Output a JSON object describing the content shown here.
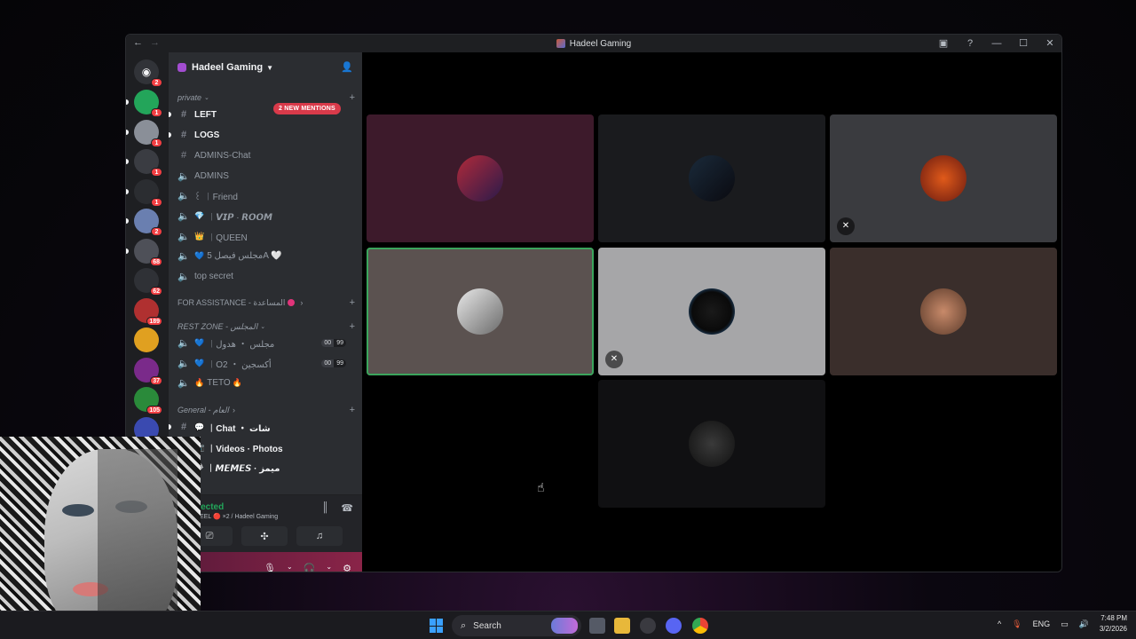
{
  "window": {
    "title": "Hadeel Gaming",
    "nav_back": "←",
    "nav_forward": "→",
    "controls": {
      "inbox": "▣",
      "help": "?",
      "minimize": "—",
      "maximize": "☐",
      "close": "✕"
    }
  },
  "server_rail": {
    "home_icon": "discord-logo-icon",
    "home_badge": "2",
    "servers": [
      {
        "badge": "1",
        "color": "#23a55a"
      },
      {
        "badge": "1",
        "color": "#8a8f98"
      },
      {
        "badge": "1",
        "color": "#3a3c42"
      },
      {
        "badge": "1",
        "color": "#2b2d31"
      },
      {
        "badge": "2",
        "color": "#6a7fb0"
      },
      {
        "badge": "68",
        "color": "#4e5058"
      },
      {
        "badge": "62",
        "color": "#2f3136"
      },
      {
        "badge": "189",
        "color": "#b03030"
      },
      {
        "badge": "",
        "color": "#e0a020"
      },
      {
        "badge": "37",
        "color": "#7a2a8a"
      },
      {
        "badge": "105",
        "color": "#2a8a3a"
      },
      {
        "badge": "674",
        "color": "#3a4ab0"
      }
    ]
  },
  "guild": {
    "name": "Hadeel Gaming",
    "mentions_label": "2 NEW MENTIONS"
  },
  "categories": {
    "private": "private",
    "assistance": "FOR ASSISTANCE - المساعدة",
    "rest_zone": "REST ZONE - المجلس",
    "general": "General - العام"
  },
  "channels": {
    "left": "LEFT",
    "logs": "LOGS",
    "admins_chat": "ADMINS-Chat",
    "admins": "ADMINS",
    "friend": "꒰ ︱Friend",
    "vip": "︱𝙑𝙄𝙋 · 𝙍𝙊𝙊𝙈",
    "queen": "︱QUEEN",
    "majlis_faisal": "مجلس فيصل 5A 🤍",
    "top_secret": "top secret",
    "majlis_hadol": "︱مجلس ・ هدول",
    "oxygen": "︱O2 ・ أكسجين",
    "teto": "TETO",
    "chat": "︱Chat ・ شات",
    "videos": "︱Videos · Photos",
    "memes": "︱𝙈𝙀𝙈𝙀𝙎 · ميمز"
  },
  "voice_limits": {
    "hadol": [
      "00",
      "99"
    ],
    "oxygen": [
      "00",
      "99"
    ]
  },
  "voice": {
    "status": "nected",
    "sub": "DEEL 🔴 ×2 / Hadeel Gaming"
  },
  "taskbar": {
    "search_placeholder": "Search",
    "lang": "ENG",
    "time": "7:48 PM",
    "date": "3/2/2026"
  },
  "tiles": [
    {
      "bg": "#3d1a2b",
      "muted": false,
      "active": false,
      "avatar": "linear-gradient(135deg,#b02a3a,#2a1a4a)"
    },
    {
      "bg": "#1a1b1e",
      "muted": false,
      "active": false,
      "avatar": "linear-gradient(135deg,#1a2a3a,#0a0a10)"
    },
    {
      "bg": "#3a3b3f",
      "muted": true,
      "active": false,
      "avatar": "radial-gradient(circle,#e05a1a,#6a1a10)"
    },
    {
      "bg": "#5b5250",
      "muted": false,
      "active": true,
      "avatar": "linear-gradient(135deg,#e8e8e8,#6a6a6a)"
    },
    {
      "bg": "#a6a6a8",
      "muted": true,
      "active": false,
      "avatar": "radial-gradient(circle,#1a1a1a,#0a0a0a 60%,#3a8ad8)"
    },
    {
      "bg": "#3a2e2b",
      "muted": false,
      "active": false,
      "avatar": "radial-gradient(circle,#c88a6a,#5a3a2a)"
    },
    {
      "bg": "#101012",
      "muted": false,
      "active": false,
      "avatar": "radial-gradient(circle,#3a3a3a,#101010)"
    }
  ]
}
